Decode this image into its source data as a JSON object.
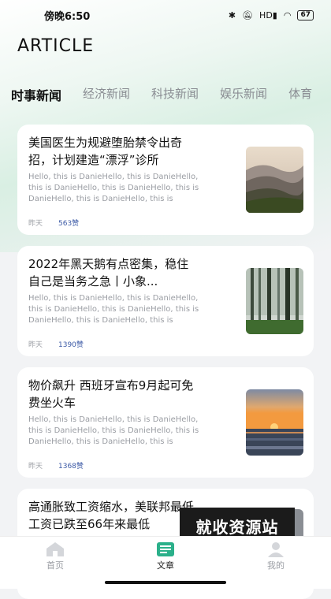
{
  "status_bar": {
    "time": "傍晚6:50",
    "signal_text": "HD",
    "battery": "67"
  },
  "app_title": "ARTICLE",
  "tabs": [
    {
      "label": "时事新闻"
    },
    {
      "label": "经济新闻"
    },
    {
      "label": "科技新闻"
    },
    {
      "label": "娱乐新闻"
    },
    {
      "label": "体育"
    }
  ],
  "articles": [
    {
      "title": "美国医生为规避堕胎禁令出奇招，计划建造“漂浮”诊所",
      "desc": "Hello, this is DanieHello, this is DanieHello, this is DanieHello, this is DanieHello, this is DanieHello, this is DanieHello, this is",
      "time": "昨天",
      "likes": "563赞",
      "image": "mountains"
    },
    {
      "title": "2022年黑天鹅有点密集，稳住自己是当务之急丨小象...",
      "desc": "Hello, this is DanieHello, this is DanieHello, this is DanieHello, this is DanieHello, this is DanieHello, this is DanieHello, this is",
      "time": "昨天",
      "likes": "1390赞",
      "image": "forest"
    },
    {
      "title": "物价飙升 西班牙宣布9月起可免费坐火车",
      "desc": "Hello, this is DanieHello, this is DanieHello, this is DanieHello, this is DanieHello, this is DanieHello, this is DanieHello, this is",
      "time": "昨天",
      "likes": "1368赞",
      "image": "sunset"
    },
    {
      "title": "高通胀致工资缩水，美联邦最低工资已跌至66年来最低",
      "desc": "",
      "time": "",
      "likes": "",
      "image": "partial"
    }
  ],
  "watermark": "就收资源站",
  "bottom_nav": [
    {
      "label": "首页",
      "icon": "home-icon"
    },
    {
      "label": "文章",
      "icon": "article-icon"
    },
    {
      "label": "我的",
      "icon": "profile-icon"
    }
  ]
}
